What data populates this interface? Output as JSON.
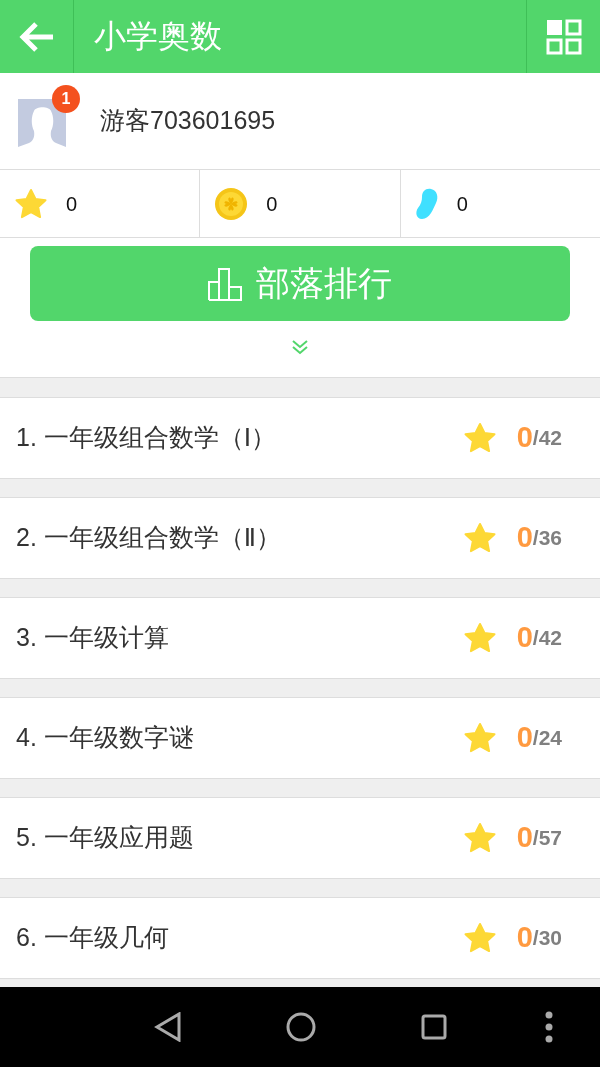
{
  "header": {
    "title": "小学奥数"
  },
  "profile": {
    "name": "游客703601695",
    "badge": "1"
  },
  "stats": [
    {
      "kind": "star",
      "value": "0"
    },
    {
      "kind": "coin",
      "value": "0"
    },
    {
      "kind": "drop",
      "value": "0"
    }
  ],
  "rank_button": {
    "label": "部落排行"
  },
  "lessons": [
    {
      "title": "1. 一年级组合数学（Ⅰ）",
      "score": "0",
      "total": "/42"
    },
    {
      "title": "2. 一年级组合数学（Ⅱ）",
      "score": "0",
      "total": "/36"
    },
    {
      "title": "3. 一年级计算",
      "score": "0",
      "total": "/42"
    },
    {
      "title": "4. 一年级数字谜",
      "score": "0",
      "total": "/24"
    },
    {
      "title": "5. 一年级应用题",
      "score": "0",
      "total": "/57"
    },
    {
      "title": "6. 一年级几何",
      "score": "0",
      "total": "/30"
    }
  ]
}
